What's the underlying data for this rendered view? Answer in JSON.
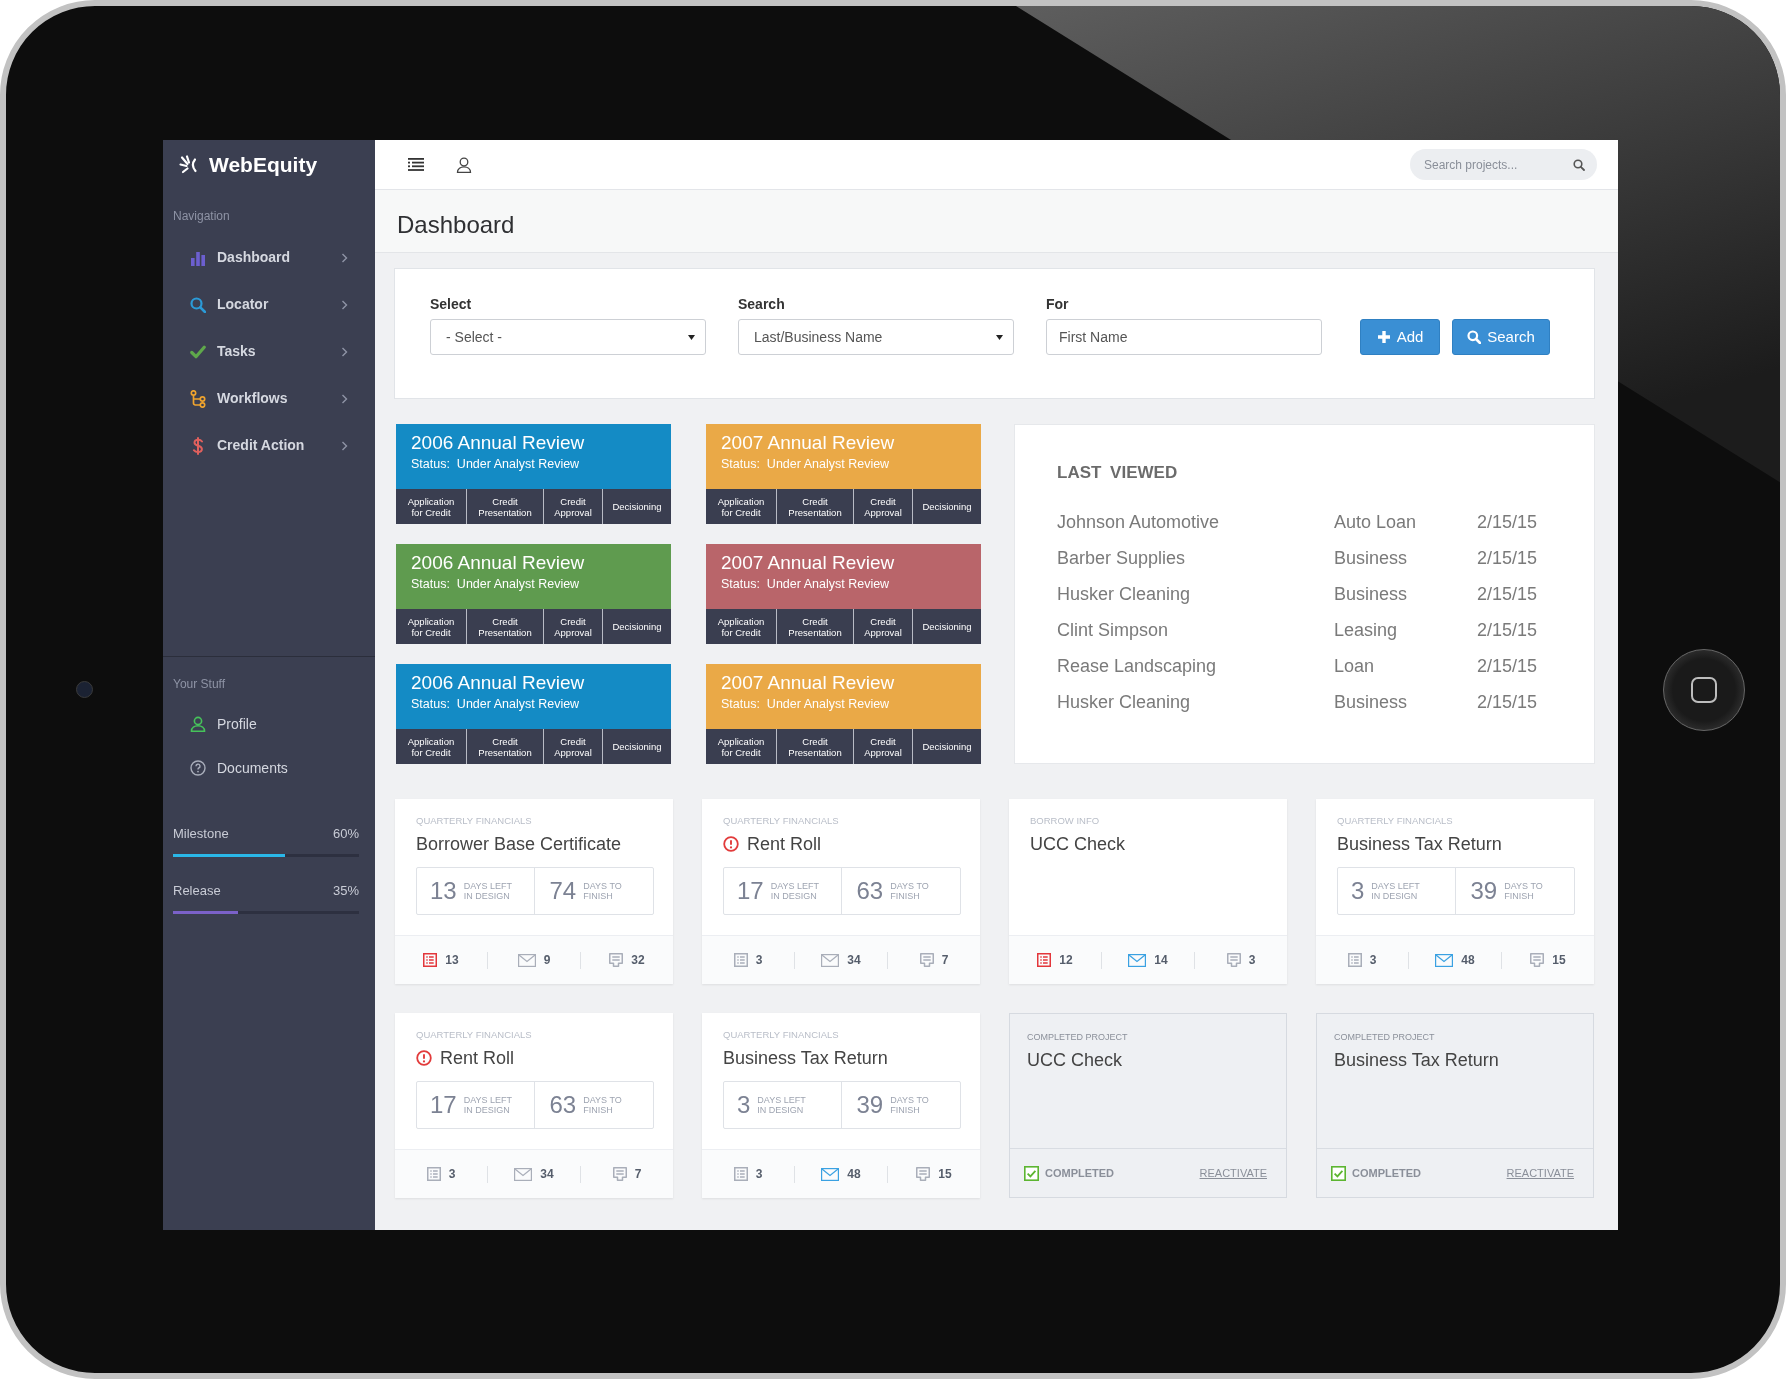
{
  "sidebar": {
    "logo": "WebEquity",
    "sections": [
      {
        "kind": "menu",
        "heading": "Navigation",
        "items": [
          {
            "label": "Dashboard"
          },
          {
            "label": "Locator"
          },
          {
            "label": "Tasks"
          },
          {
            "label": "Workflows"
          },
          {
            "label": "Credit Action"
          }
        ]
      },
      {
        "kind": "links",
        "heading": "Your Stuff",
        "items": [
          {
            "label": "Profile"
          },
          {
            "label": "Documents"
          }
        ]
      }
    ],
    "progress": [
      {
        "label": "Milestone",
        "reading": "60%",
        "level": 0.6,
        "color": "#2ab7e8"
      },
      {
        "label": "Release",
        "reading": "35%",
        "level": 0.35,
        "color": "#7b61c9"
      }
    ]
  },
  "top_bar": {
    "search": {
      "placeholder": "Search projects..."
    }
  },
  "page_title": "Dashboard",
  "search_form": {
    "fields": [
      {
        "kind": "select",
        "label": "Select",
        "value": "- Select -"
      },
      {
        "kind": "select",
        "label": "Search",
        "value": "Last/Business Name"
      },
      {
        "kind": "input",
        "label": "For",
        "placeholder": "First Name"
      }
    ],
    "buttons": [
      {
        "label": "Add"
      },
      {
        "label": "Search"
      }
    ]
  },
  "review_cards": [
    {
      "title": "2006 Annual Review",
      "status": "Status:  Under Analyst Review",
      "color": "#148bc5",
      "stages": [
        "Application for Credit",
        "Credit Presentation",
        "Credit Approval",
        "Decisioning"
      ]
    },
    {
      "title": "2007 Annual Review",
      "status": "Status:  Under Analyst Review",
      "color": "#eaa947",
      "stages": [
        "Application for Credit",
        "Credit Presentation",
        "Credit Approval",
        "Decisioning"
      ]
    },
    {
      "title": "2006 Annual Review",
      "status": "Status:  Under Analyst Review",
      "color": "#5f9b4f",
      "stages": [
        "Application for Credit",
        "Credit Presentation",
        "Credit Approval",
        "Decisioning"
      ]
    },
    {
      "title": "2007 Annual Review",
      "status": "Status:  Under Analyst Review",
      "color": "#b9656a",
      "stages": [
        "Application for Credit",
        "Credit Presentation",
        "Credit Approval",
        "Decisioning"
      ]
    },
    {
      "title": "2006 Annual Review",
      "status": "Status:  Under Analyst Review",
      "color": "#148bc5",
      "stages": [
        "Application for Credit",
        "Credit Presentation",
        "Credit Approval",
        "Decisioning"
      ]
    },
    {
      "title": "2007 Annual Review",
      "status": "Status:  Under Analyst Review",
      "color": "#eaa947",
      "stages": [
        "Application for Credit",
        "Credit Presentation",
        "Credit Approval",
        "Decisioning"
      ]
    }
  ],
  "last_viewed": {
    "title": "LAST VIEWED",
    "rows": [
      {
        "name": "Johnson Automotive",
        "type": "Auto Loan",
        "date": "2/15/15"
      },
      {
        "name": "Barber Supplies",
        "type": "Business",
        "date": "2/15/15"
      },
      {
        "name": "Husker Cleaning",
        "type": "Business",
        "date": "2/15/15"
      },
      {
        "name": "Clint Simpson",
        "type": "Leasing",
        "date": "2/15/15"
      },
      {
        "name": "Rease Landscaping",
        "type": "Loan",
        "date": "2/15/15"
      },
      {
        "name": "Husker Cleaning",
        "type": "Business",
        "date": "2/15/15"
      }
    ]
  },
  "project_cards": [
    {
      "kind": "active",
      "category": "QUARTERLY FINANCIALS",
      "title": "Borrower Base Certificate",
      "alert": false,
      "days": [
        {
          "number": "13",
          "label": "DAYS LEFT IN DESIGN"
        },
        {
          "number": "74",
          "label": "DAYS TO FINISH"
        }
      ],
      "stats": [
        {
          "count": "13",
          "highlighted": true
        },
        {
          "count": "9",
          "highlighted": false
        },
        {
          "count": "32",
          "highlighted": false
        }
      ]
    },
    {
      "kind": "active",
      "category": "QUARTERLY FINANCIALS",
      "title": "Rent Roll",
      "alert": true,
      "days": [
        {
          "number": "17",
          "label": "DAYS LEFT IN DESIGN"
        },
        {
          "number": "63",
          "label": "DAYS TO FINISH"
        }
      ],
      "stats": [
        {
          "count": "3",
          "highlighted": false
        },
        {
          "count": "34",
          "highlighted": false
        },
        {
          "count": "7",
          "highlighted": false
        }
      ]
    },
    {
      "kind": "active",
      "category": "BORROW INFO",
      "title": "UCC Check",
      "alert": false,
      "stats": [
        {
          "count": "12",
          "highlighted": true
        },
        {
          "count": "14",
          "highlighted": true
        },
        {
          "count": "3",
          "highlighted": false
        }
      ]
    },
    {
      "kind": "active",
      "category": "QUARTERLY FINANCIALS",
      "title": "Business Tax Return",
      "alert": false,
      "days": [
        {
          "number": "3",
          "label": "DAYS LEFT IN DESIGN"
        },
        {
          "number": "39",
          "label": "DAYS TO FINISH"
        }
      ],
      "stats": [
        {
          "count": "3",
          "highlighted": false
        },
        {
          "count": "48",
          "highlighted": true
        },
        {
          "count": "15",
          "highlighted": false
        }
      ]
    },
    {
      "kind": "active",
      "category": "QUARTERLY FINANCIALS",
      "title": "Rent Roll",
      "alert": true,
      "days": [
        {
          "number": "17",
          "label": "DAYS LEFT IN DESIGN"
        },
        {
          "number": "63",
          "label": "DAYS TO FINISH"
        }
      ],
      "stats": [
        {
          "count": "3",
          "highlighted": false
        },
        {
          "count": "34",
          "highlighted": false
        },
        {
          "count": "7",
          "highlighted": false
        }
      ]
    },
    {
      "kind": "active",
      "category": "QUARTERLY FINANCIALS",
      "title": "Business Tax Return",
      "alert": false,
      "days": [
        {
          "number": "3",
          "label": "DAYS LEFT IN DESIGN"
        },
        {
          "number": "39",
          "label": "DAYS TO FINISH"
        }
      ],
      "stats": [
        {
          "count": "3",
          "highlighted": false
        },
        {
          "count": "48",
          "highlighted": true
        },
        {
          "count": "15",
          "highlighted": false
        }
      ]
    },
    {
      "kind": "completed",
      "category": "COMPLETED PROJECT",
      "title": "UCC Check",
      "status": "COMPLETED",
      "checked": true,
      "action": "REACTIVATE"
    },
    {
      "kind": "completed",
      "category": "COMPLETED PROJECT",
      "title": "Business Tax Return",
      "status": "COMPLETED",
      "checked": true,
      "action": "REACTIVATE"
    }
  ]
}
